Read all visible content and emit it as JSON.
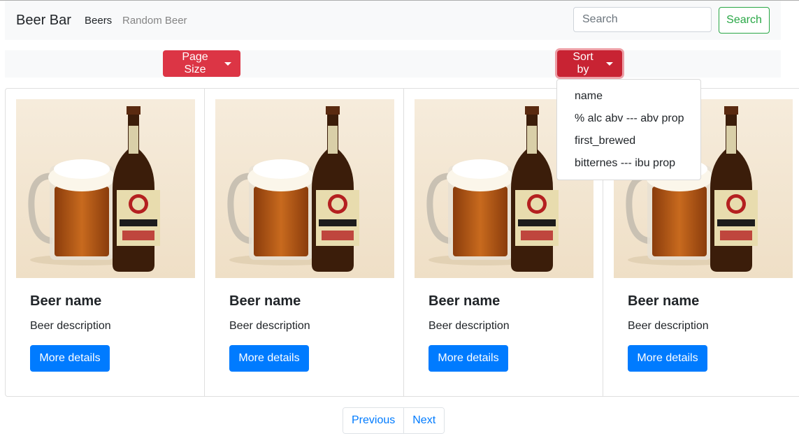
{
  "navbar": {
    "brand": "Beer Bar",
    "links": [
      "Beers",
      "Random Beer"
    ],
    "search_placeholder": "Search",
    "search_button": "Search"
  },
  "toolbar": {
    "page_size_label": "Page Size",
    "sort_by_label": "Sort by"
  },
  "sort_menu": {
    "items": [
      "name",
      "% alc abv --- abv prop",
      "first_brewed",
      "bitternes --- ibu prop"
    ]
  },
  "cards": [
    {
      "title": "Beer name",
      "description": "Beer description",
      "button": "More details"
    },
    {
      "title": "Beer name",
      "description": "Beer description",
      "button": "More details"
    },
    {
      "title": "Beer name",
      "description": "Beer description",
      "button": "More details"
    },
    {
      "title": "Beer name",
      "description": "Beer description",
      "button": "More details"
    }
  ],
  "pagination": {
    "previous": "Previous",
    "next": "Next"
  },
  "colors": {
    "danger": "#dc3545",
    "primary": "#007bff",
    "success": "#28a745",
    "light_bg": "#f8f9fa"
  }
}
